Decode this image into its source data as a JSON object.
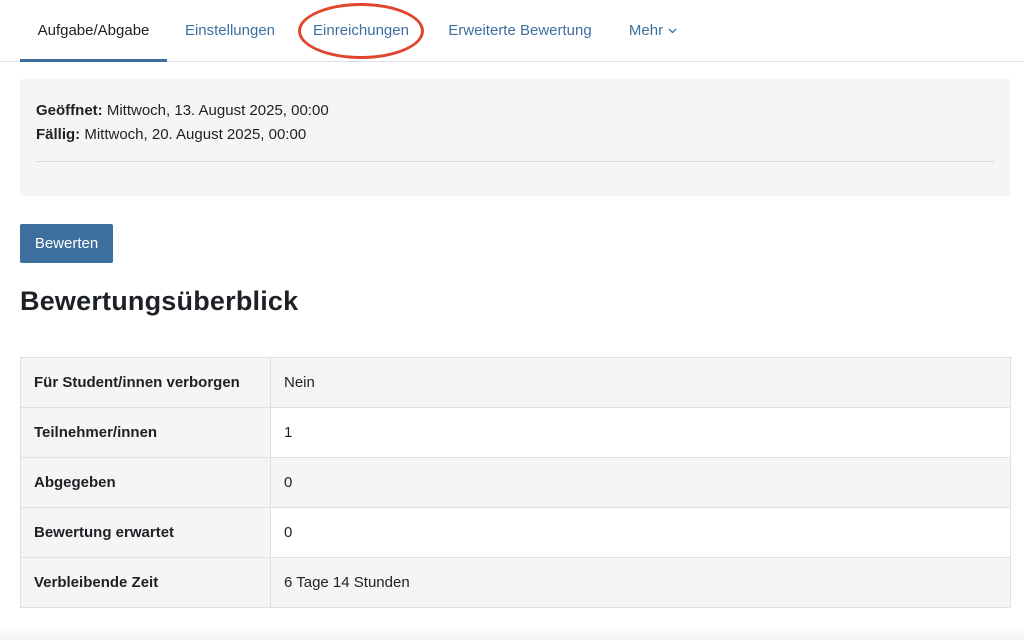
{
  "nav": {
    "tabs": [
      {
        "label": "Aufgabe/Abgabe",
        "active": true
      },
      {
        "label": "Einstellungen",
        "active": false
      },
      {
        "label": "Einreichungen",
        "active": false,
        "highlighted": true
      },
      {
        "label": "Erweiterte Bewertung",
        "active": false
      },
      {
        "label": "Mehr",
        "active": false,
        "dropdown": true
      }
    ]
  },
  "dates": {
    "opened_label": "Geöffnet:",
    "opened_value": "Mittwoch, 13. August 2025, 00:00",
    "due_label": "Fällig:",
    "due_value": "Mittwoch, 20. August 2025, 00:00"
  },
  "actions": {
    "grade_button": "Bewerten"
  },
  "summary": {
    "title": "Bewertungsüberblick",
    "rows": [
      {
        "key": "Für Student/innen verborgen",
        "value": "Nein"
      },
      {
        "key": "Teilnehmer/innen",
        "value": "1"
      },
      {
        "key": "Abgegeben",
        "value": "0"
      },
      {
        "key": "Bewertung erwartet",
        "value": "0"
      },
      {
        "key": "Verbleibende Zeit",
        "value": "6 Tage 14 Stunden"
      }
    ]
  },
  "colors": {
    "accent": "#3d6f9e",
    "highlight_ring": "#e2452d",
    "panel_bg": "#f5f5f5"
  }
}
